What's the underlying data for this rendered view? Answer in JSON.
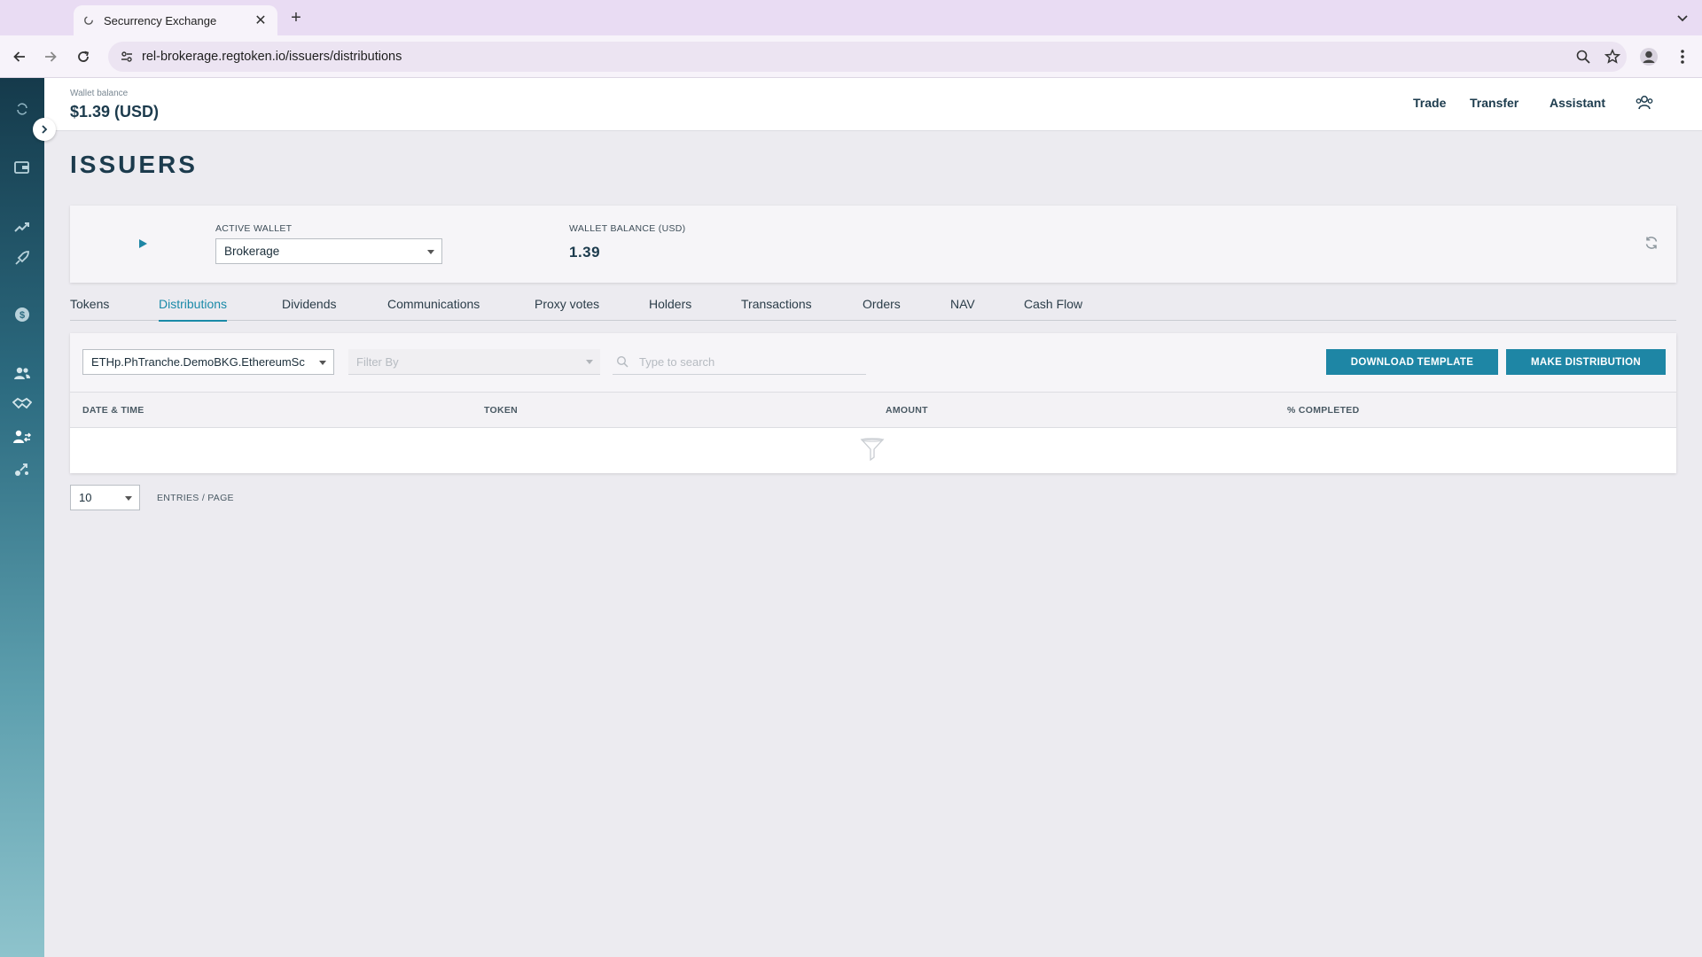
{
  "browser": {
    "tab_title": "Securrency Exchange",
    "url": "rel-brokerage.regtoken.io/issuers/distributions"
  },
  "header": {
    "wallet_balance_label": "Wallet balance",
    "wallet_balance_value": "$1.39 (USD)",
    "links": [
      "Trade",
      "Transfer",
      "Assistant"
    ]
  },
  "sidebar": {
    "icons": [
      "sync-icon",
      "wallet-icon",
      "trending-up-icon",
      "rocket-icon",
      "dollar-icon",
      "users-icon",
      "handshake-icon",
      "user-transfer-icon",
      "distribution-icon"
    ]
  },
  "page": {
    "title": "ISSUERS",
    "wallet_card": {
      "active_wallet_label": "ACTIVE WALLET",
      "active_wallet_value": "Brokerage",
      "balance_label": "WALLET BALANCE (USD)",
      "balance_value": "1.39"
    },
    "tabs": [
      {
        "label": "Tokens"
      },
      {
        "label": "Distributions",
        "active": true
      },
      {
        "label": "Dividends"
      },
      {
        "label": "Communications"
      },
      {
        "label": "Proxy votes"
      },
      {
        "label": "Holders"
      },
      {
        "label": "Transactions"
      },
      {
        "label": "Orders"
      },
      {
        "label": "NAV"
      },
      {
        "label": "Cash Flow"
      }
    ],
    "filters": {
      "token_value": "ETHp.PhTranche.DemoBKG.EthereumSc",
      "filter_by_placeholder": "Filter By",
      "search_placeholder": "Type to search"
    },
    "buttons": {
      "download_template": "DOWNLOAD TEMPLATE",
      "make_distribution": "MAKE DISTRIBUTION"
    },
    "table": {
      "columns": [
        "DATE & TIME",
        "TOKEN",
        "AMOUNT",
        "% COMPLETED"
      ],
      "rows": []
    },
    "pagination": {
      "page_size": "10",
      "label": "ENTRIES / PAGE"
    }
  },
  "colors": {
    "accent": "#1e86a5",
    "active_tab": "#1a8aa8",
    "heading": "#1c3b4d",
    "tabstrip": "#e9dcf3"
  }
}
